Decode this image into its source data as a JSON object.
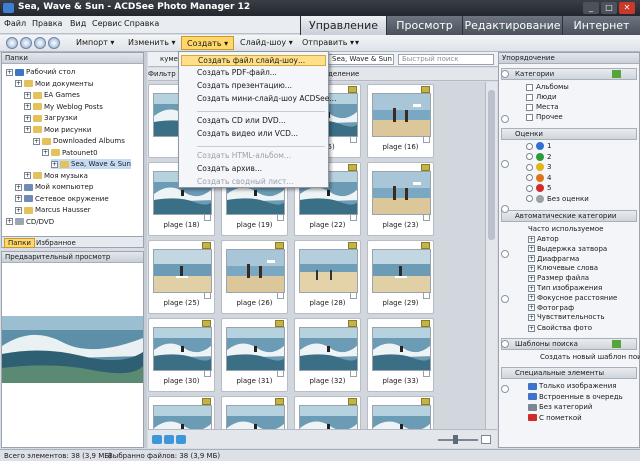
{
  "window": {
    "title": "Sea, Wave & Sun - ACDSee Photo Manager 12"
  },
  "menu": [
    "Файл",
    "Правка",
    "Вид",
    "Сервис",
    "Справка"
  ],
  "modes": [
    {
      "label": "Управление",
      "active": true
    },
    {
      "label": "Просмотр",
      "active": false
    },
    {
      "label": "Редактирование",
      "active": false
    },
    {
      "label": "Интернет",
      "active": false
    }
  ],
  "toolbar": {
    "import": "Импорт ▾",
    "edit": "Изменить ▾",
    "create": "Создать ▾",
    "slideshow": "Слайд-шоу ▾",
    "send": "Отправить ▾",
    "more": "▾"
  },
  "folders_panel": {
    "title": "Папки",
    "items": [
      {
        "label": "Рабочий стол",
        "indent": 0,
        "icon": "desktop-icon",
        "color": "#3d74c9"
      },
      {
        "label": "Мои документы",
        "indent": 1,
        "icon": "folder-icon",
        "color": "#e3c25c"
      },
      {
        "label": "EA Games",
        "indent": 2,
        "icon": "folder-icon",
        "color": "#e3c25c"
      },
      {
        "label": "My Weblog Posts",
        "indent": 2,
        "icon": "folder-icon",
        "color": "#e3c25c"
      },
      {
        "label": "Загрузки",
        "indent": 2,
        "icon": "folder-icon",
        "color": "#e3c25c"
      },
      {
        "label": "Мои рисунки",
        "indent": 2,
        "icon": "folder-icon",
        "color": "#e3c25c"
      },
      {
        "label": "Downloaded Albums",
        "indent": 3,
        "icon": "folder-icon",
        "color": "#e3c25c"
      },
      {
        "label": "Patounet0",
        "indent": 4,
        "icon": "folder-icon",
        "color": "#e3c25c"
      },
      {
        "label": "Sea, Wave & Sun",
        "indent": 5,
        "icon": "folder-icon",
        "color": "#e3c25c",
        "selected": true
      },
      {
        "label": "Моя музыка",
        "indent": 2,
        "icon": "folder-icon",
        "color": "#e3c25c"
      },
      {
        "label": "Мой компьютер",
        "indent": 1,
        "icon": "computer-icon",
        "color": "#6f8db4"
      },
      {
        "label": "Сетевое окружение",
        "indent": 1,
        "icon": "network-icon",
        "color": "#6f8db4"
      },
      {
        "label": "Marcus Hausser",
        "indent": 1,
        "icon": "folder-icon",
        "color": "#e3c25c"
      },
      {
        "label": "CD/DVD",
        "indent": 0,
        "icon": "disc-icon",
        "color": "#9aa6b4"
      }
    ],
    "tabs": [
      "Папки",
      "Избранное"
    ]
  },
  "preview_panel": {
    "title": "Предварительный просмотр"
  },
  "breadcrumb": {
    "left": "куме",
    "folder": "Sea, Wave & Sun",
    "search_placeholder": "Быстрый поиск"
  },
  "filter_bar": {
    "filter": "Фильтр",
    "group": "деление"
  },
  "dropdown": {
    "items": [
      {
        "label": "Создать файл слайд-шоу...",
        "highlight": true
      },
      {
        "label": "Создать PDF-файл..."
      },
      {
        "label": "Создать презентацию..."
      },
      {
        "label": "Создать мини-слайд-шоу ACDSee..."
      },
      {
        "sep": true
      },
      {
        "label": "Создать CD или DVD..."
      },
      {
        "label": "Создать видео или VCD..."
      },
      {
        "sep": true
      },
      {
        "label": "Создать HTML-альбом...",
        "disabled": true
      },
      {
        "label": "Создать архив..."
      },
      {
        "label": "Создать сводный лист...",
        "disabled": true
      }
    ]
  },
  "thumbnails": [
    {
      "label": "",
      "scene": "wave"
    },
    {
      "label": "",
      "scene": "wave"
    },
    {
      "label": "(15)",
      "scene": "wave"
    },
    {
      "label": "plage (16)",
      "scene": "beach"
    },
    {
      "label": "plage (18)",
      "scene": "wave"
    },
    {
      "label": "plage (19)",
      "scene": "wave"
    },
    {
      "label": "plage (22)",
      "scene": "wave"
    },
    {
      "label": "plage (23)",
      "scene": "beach"
    },
    {
      "label": "plage (25)",
      "scene": "surf"
    },
    {
      "label": "plage (26)",
      "scene": "beach"
    },
    {
      "label": "plage (28)",
      "scene": "sand"
    },
    {
      "label": "plage (29)",
      "scene": "surf"
    },
    {
      "label": "plage (30)",
      "scene": "wave"
    },
    {
      "label": "plage (31)",
      "scene": "wave"
    },
    {
      "label": "plage (32)",
      "scene": "wave"
    },
    {
      "label": "plage (33)",
      "scene": "wave"
    },
    {
      "label": "",
      "scene": "wave"
    },
    {
      "label": "",
      "scene": "wave"
    },
    {
      "label": "",
      "scene": "wave"
    },
    {
      "label": "",
      "scene": "wave"
    }
  ],
  "right_panel": {
    "title": "Упорядочение",
    "categories_title": "Категории",
    "categories": [
      "Альбомы",
      "Люди",
      "Места",
      "Прочее"
    ],
    "ratings_title": "Оценки",
    "ratings": [
      {
        "label": "1",
        "color": "#2f6fd6"
      },
      {
        "label": "2",
        "color": "#2b9b3c"
      },
      {
        "label": "3",
        "color": "#e0b415"
      },
      {
        "label": "4",
        "color": "#e07318"
      },
      {
        "label": "5",
        "color": "#d12a2a"
      },
      {
        "label": "Без оценки",
        "color": "#9aa0a8",
        "selected": true
      }
    ],
    "auto_title": "Автоматические категории",
    "auto_root": "Часто используемое",
    "auto_items": [
      "Автор",
      "Выдержка затвора",
      "Диафрагма",
      "Ключевые слова",
      "Размер файла",
      "Тип изображения",
      "Фокусное расстояние",
      "Фотограф",
      "Чувствительность"
    ],
    "auto_last": "Свойства фото",
    "search_title": "Шаблоны поиска",
    "search_new": "Создать новый шаблон поиска",
    "special_title": "Специальные элементы",
    "special": [
      {
        "label": "Только изображения",
        "color": "#3d74c9"
      },
      {
        "label": "Встроенные в очередь",
        "color": "#3d74c9"
      },
      {
        "label": "Без категорий",
        "color": "#7b8794"
      },
      {
        "label": "С пометкой",
        "color": "#d12a2a"
      }
    ]
  },
  "status": {
    "total": "Всего элементов: 38 (3,9 МБ)",
    "selected": "Выбранно файлов: 38 (3,9 МБ)"
  }
}
